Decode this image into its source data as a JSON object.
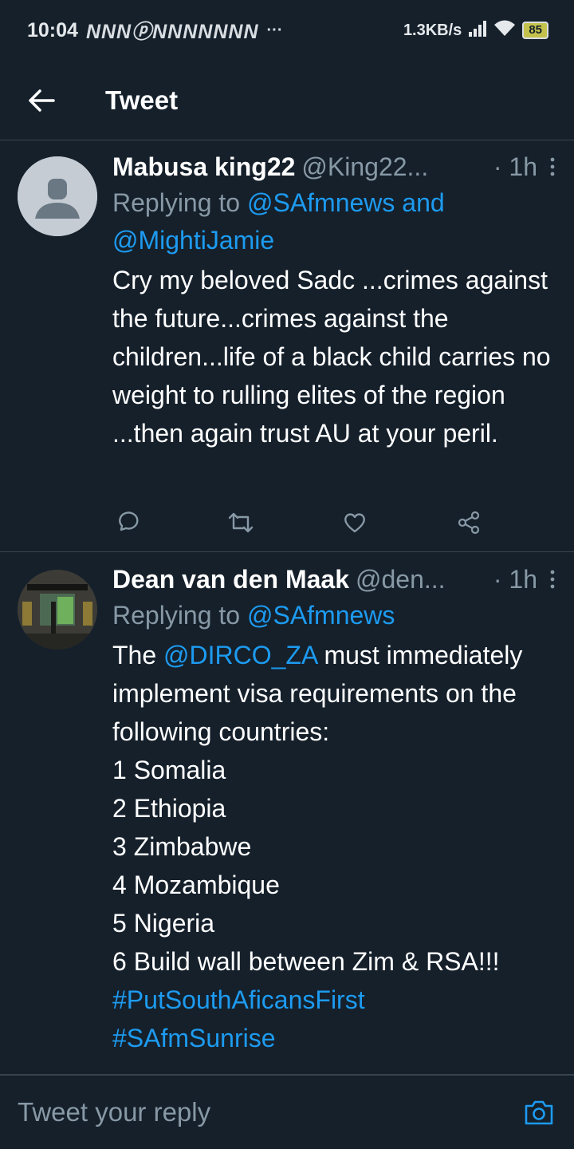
{
  "status_bar": {
    "time": "10:04",
    "notifications": "NNNⓟNNNNNNN",
    "more": "···",
    "network_speed": "1.3KB/s",
    "battery": "85"
  },
  "header": {
    "title": "Tweet"
  },
  "tweets": [
    {
      "name": "Mabusa king22",
      "handle": "@King22...",
      "time": "· 1h",
      "replying_prefix": "Replying to ",
      "replying_to": "@SAfmnews and @MightiJamie",
      "text": "Cry my beloved Sadc ...crimes against the future...crimes against the children...life of a black child carries no weight to rulling elites of the region ...then again trust AU at your peril."
    },
    {
      "name": "Dean van den Maak",
      "handle": "@den...",
      "time": "· 1h",
      "replying_prefix": "Replying to ",
      "replying_to": "@SAfmnews",
      "text_prefix": "The ",
      "mention": "@DIRCO_ZA",
      "text_rest": " must immediately implement visa requirements on the following countries:\n1 Somalia\n2 Ethiopia\n3 Zimbabwe\n4 Mozambique\n5 Nigeria\n6 Build wall between Zim & RSA!!!",
      "hashtags": [
        "#PutSouthAficansFirst",
        "#SAfmSunrise"
      ]
    }
  ],
  "composer": {
    "placeholder": "Tweet your reply"
  },
  "colors": {
    "background": "#15202b",
    "accent": "#1d9bf0",
    "muted": "#8899a6",
    "divider": "#38444d"
  }
}
